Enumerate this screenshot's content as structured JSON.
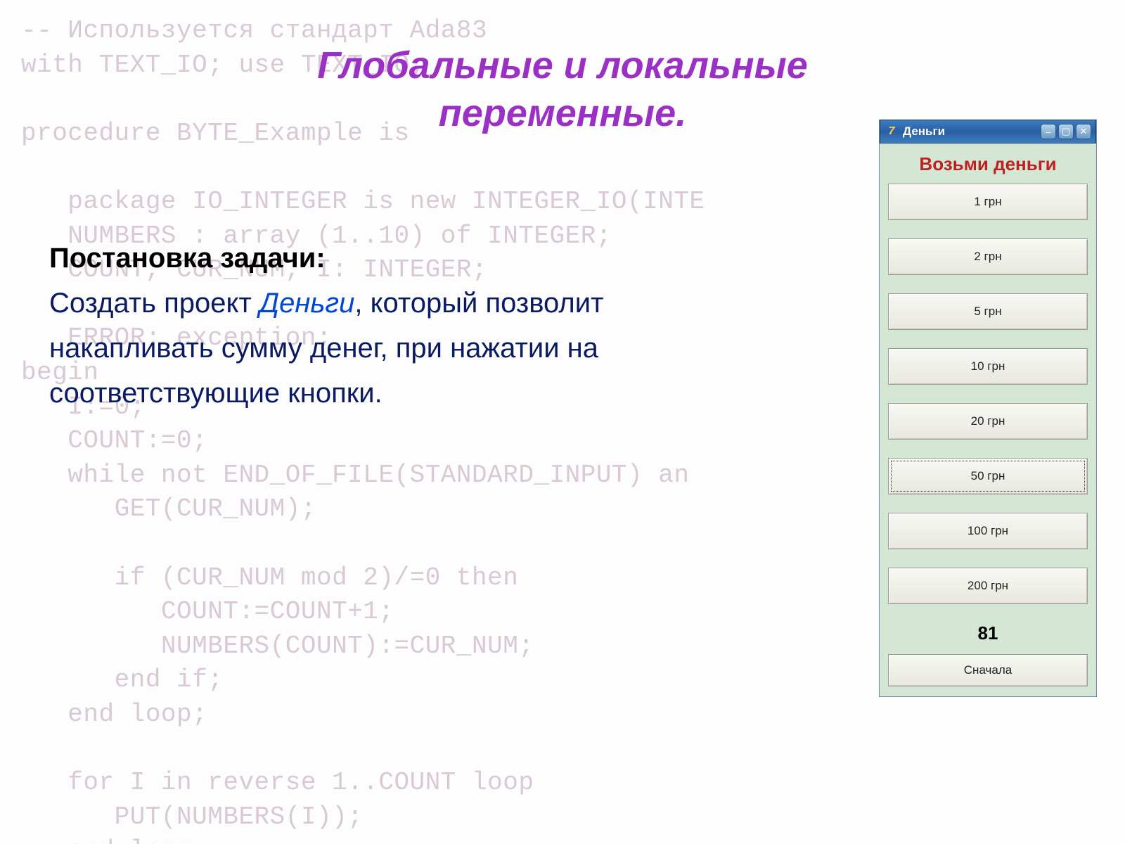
{
  "slide": {
    "title_line1": "Глобальные и локальные",
    "title_line2": "переменные."
  },
  "task": {
    "heading": "Постановка задачи:",
    "text_pre": "Создать проект ",
    "project_name": "Деньги",
    "text_post": ", который позволит накапливать сумму денег, при нажатии на соответствующие кнопки."
  },
  "ghost_code": "-- Используется стандарт Ada83\nwith TEXT_IO; use TEXT_IO;\n\nprocedure BYTE_Example is\n\n   package IO_INTEGER is new INTEGER_IO(INTE\n   NUMBERS : array (1..10) of INTEGER;\n   COUNT, CUR_NUM, I: INTEGER;\n\n   ERROR: exception;\nbegin\n   I:=0;\n   COUNT:=0;\n   while not END_OF_FILE(STANDARD_INPUT) an\n      GET(CUR_NUM);\n\n      if (CUR_NUM mod 2)/=0 then\n         COUNT:=COUNT+1;\n         NUMBERS(COUNT):=CUR_NUM;\n      end if;\n   end loop;\n\n   for I in reverse 1..COUNT loop\n      PUT(NUMBERS(I));\n   end loop;\nexception\n   when DATA_ERROR =>\n      PUT(\"Неверный формат числа в строке\n      raise ERROR;\nend BYTE_Example;",
  "app": {
    "window_title": "Деньги",
    "heading": "Возьми деньги",
    "buttons": [
      {
        "label": "1 грн",
        "focused": false
      },
      {
        "label": "2 грн",
        "focused": false
      },
      {
        "label": "5 грн",
        "focused": false
      },
      {
        "label": "10 грн",
        "focused": false
      },
      {
        "label": "20 грн",
        "focused": false
      },
      {
        "label": "50 грн",
        "focused": true
      },
      {
        "label": "100 грн",
        "focused": false
      },
      {
        "label": "200 грн",
        "focused": false
      }
    ],
    "counter": "81",
    "reset_label": "Сначала",
    "window_controls": {
      "minimize": "–",
      "maximize": "▢",
      "close": "✕"
    }
  }
}
